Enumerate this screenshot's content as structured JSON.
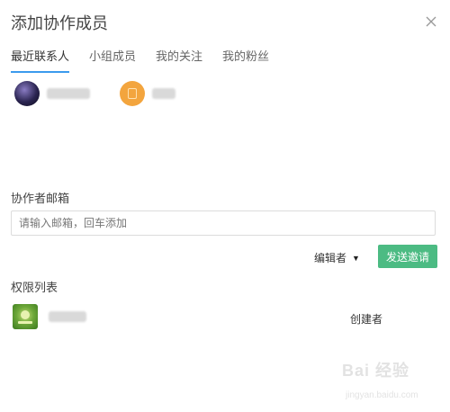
{
  "dialog": {
    "title": "添加协作成员",
    "close_icon": "close-icon"
  },
  "tabs": [
    {
      "label": "最近联系人",
      "active": true
    },
    {
      "label": "小组成员",
      "active": false
    },
    {
      "label": "我的关注",
      "active": false
    },
    {
      "label": "我的粉丝",
      "active": false
    }
  ],
  "recent_contacts": [
    {
      "avatar": "dark-avatar",
      "name": ""
    },
    {
      "avatar": "orange-avatar",
      "name": ""
    }
  ],
  "invite": {
    "email_label": "协作者邮箱",
    "email_placeholder": "请输入邮箱，回车添加",
    "email_value": "",
    "role_selected": "编辑者",
    "send_label": "发送邀请"
  },
  "permissions": {
    "label": "权限列表",
    "members": [
      {
        "name": "",
        "role": "创建者"
      }
    ]
  },
  "watermark": {
    "logo": "Bai 经验",
    "sub": "jingyan.baidu.com"
  },
  "colors": {
    "accent": "#3b9aed",
    "send_button": "#4cbb83",
    "orange_avatar": "#f3a53e"
  }
}
